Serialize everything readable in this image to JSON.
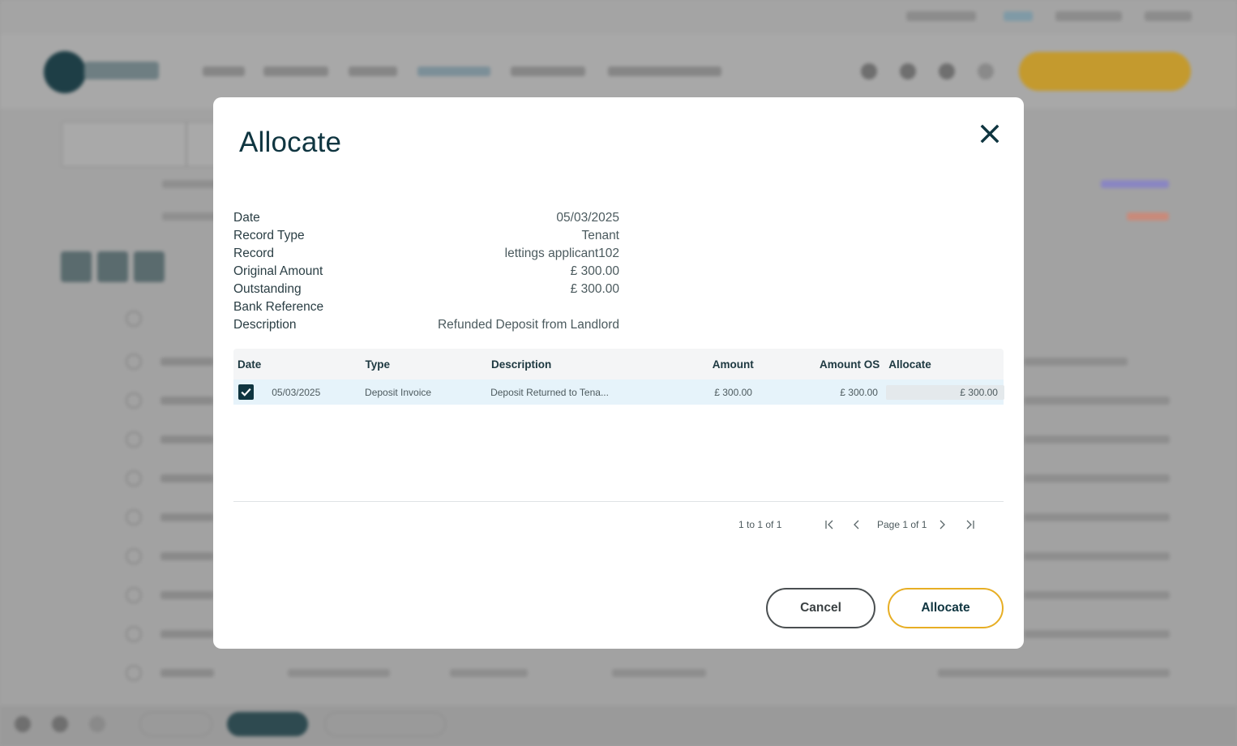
{
  "modal": {
    "title": "Allocate",
    "details": [
      {
        "label": "Date",
        "value": "05/03/2025"
      },
      {
        "label": "Record Type",
        "value": "Tenant"
      },
      {
        "label": "Record",
        "value": "lettings applicant102"
      },
      {
        "label": "Original Amount",
        "value": "£ 300.00"
      },
      {
        "label": "Outstanding",
        "value": "£ 300.00"
      },
      {
        "label": "Bank Reference",
        "value": ""
      },
      {
        "label": "Description",
        "value": "Refunded Deposit from Landlord"
      }
    ],
    "grid": {
      "headers": {
        "date": "Date",
        "type": "Type",
        "description": "Description",
        "amount": "Amount",
        "amount_os": "Amount OS",
        "allocate": "Allocate"
      },
      "rows": [
        {
          "selected": true,
          "date": "05/03/2025",
          "type": "Deposit Invoice",
          "description": "Deposit Returned to Tena...",
          "amount": "£ 300.00",
          "amount_os": "£ 300.00",
          "allocate": "£ 300.00"
        }
      ]
    },
    "pagination": {
      "range": "1 to 1 of 1",
      "page": "Page 1 of 1"
    },
    "buttons": {
      "cancel": "Cancel",
      "allocate": "Allocate"
    },
    "colors": {
      "primary": "#0f3540",
      "accent": "#e7ae24",
      "row_highlight": "#e6f3fa"
    }
  }
}
